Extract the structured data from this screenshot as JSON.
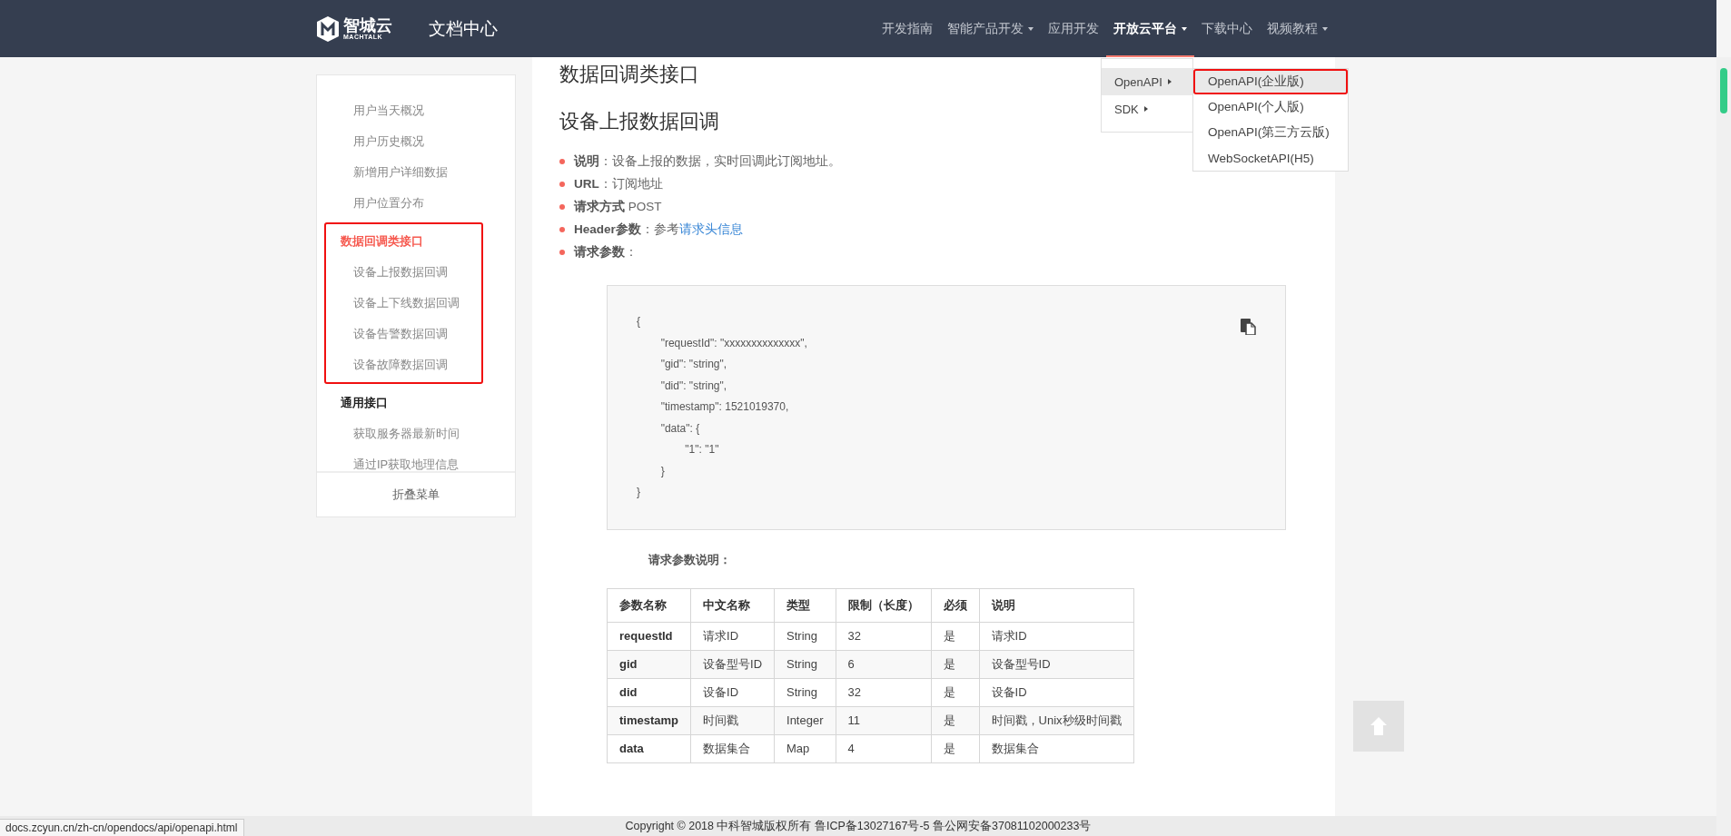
{
  "header": {
    "brand": "智城云",
    "brand_sub": "MACHTALK",
    "site_title": "文档中心",
    "nav": [
      {
        "label": "开发指南",
        "selected": false,
        "has_menu": false
      },
      {
        "label": "智能产品开发",
        "selected": false,
        "has_menu": true
      },
      {
        "label": "应用开发",
        "selected": false,
        "has_menu": false
      },
      {
        "label": "开放云平台",
        "selected": true,
        "has_menu": true
      },
      {
        "label": "下载中心",
        "selected": false,
        "has_menu": false
      },
      {
        "label": "视频教程",
        "selected": false,
        "has_menu": true
      }
    ]
  },
  "dropdown": {
    "items": [
      {
        "label": "OpenAPI",
        "selected": true
      },
      {
        "label": "SDK",
        "selected": false
      }
    ],
    "submenu": [
      {
        "label": "OpenAPI(企业版)",
        "selected": true,
        "annotated": true
      },
      {
        "label": "OpenAPI(个人版)",
        "selected": false,
        "annotated": false
      },
      {
        "label": "OpenAPI(第三方云版)",
        "selected": false,
        "annotated": false
      },
      {
        "label": "WebSocketAPI(H5)",
        "selected": false,
        "annotated": false
      }
    ]
  },
  "sidebar": {
    "sections": [
      {
        "annotated": false,
        "items": [
          "用户当天概况",
          "用户历史概况",
          "新增用户详细数据",
          "用户位置分布"
        ]
      },
      {
        "title": "数据回调类接口",
        "selected": true,
        "annotated": true,
        "items": [
          "设备上报数据回调",
          "设备上下线数据回调",
          "设备告警数据回调",
          "设备故障数据回调"
        ]
      },
      {
        "title": "通用接口",
        "selected": false,
        "annotated": false,
        "items": [
          "获取服务器最新时间",
          "通过IP获取地理信息"
        ]
      }
    ],
    "collapse_button": "折叠菜单"
  },
  "content": {
    "section_title": "数据回调类接口",
    "heading": "设备上报数据回调",
    "bullets": [
      {
        "text": "**说明**：设备上报的数据，实时回调此订阅地址。"
      },
      {
        "text": "**URL**：订阅地址"
      },
      {
        "text": "**请求方式** POST"
      },
      {
        "text": "**Header参数**：参考",
        "link": "请求头信息"
      },
      {
        "text": "**请求参数**："
      }
    ],
    "code_lines": [
      "{",
      "\t\"requestId\": \"xxxxxxxxxxxxxx\",",
      "\t\"gid\": \"string\",",
      "\t\"did\": \"string\",",
      "\t\"timestamp\": 1521019370,",
      "\t\"data\": {",
      "\t\t\"1\": \"1\"",
      "\t}",
      "}"
    ],
    "params_caption": "请求参数说明：",
    "table": {
      "columns": [
        "参数名称",
        "中文名称",
        "类型",
        "限制（长度）",
        "必须",
        "说明"
      ],
      "rows": [
        [
          "requestId",
          "请求ID",
          "String",
          "32",
          "是",
          "请求ID"
        ],
        [
          "gid",
          "设备型号ID",
          "String",
          "6",
          "是",
          "设备型号ID"
        ],
        [
          "did",
          "设备ID",
          "String",
          "32",
          "是",
          "设备ID"
        ],
        [
          "timestamp",
          "时间戳",
          "Integer",
          "11",
          "是",
          "时间戳，Unix秒级时间戳"
        ],
        [
          "data",
          "数据集合",
          "Map",
          "4",
          "是",
          "数据集合"
        ]
      ]
    }
  },
  "footer": {
    "copyright": "Copyright © 2018 中科智城版权所有 鲁ICP备13027167号-5 鲁公网安备37081102000233号"
  },
  "status_url": "docs.zcyun.cn/zh-cn/opendocs/api/openapi.html"
}
